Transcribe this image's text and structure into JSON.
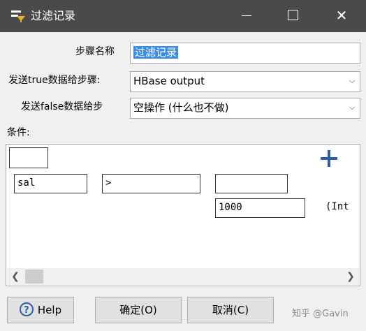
{
  "window": {
    "title": "过滤记录",
    "minimize_icon": "minimize-icon",
    "maximize_icon": "maximize-icon",
    "close_icon": "close-icon"
  },
  "form": {
    "step_name_label": "步骤名称",
    "step_name_value": "过滤记录",
    "true_step_label": "发送true数据给步骤:",
    "true_step_value": "HBase output",
    "false_step_label": "发送false数据给步",
    "false_step_value": "空操作 (什么也不做)",
    "conditions_label": "条件:"
  },
  "condition": {
    "top_box_value": "",
    "left_field": "sal",
    "operator": ">",
    "right_field": "",
    "constant_value": "1000",
    "constant_type": "(Int"
  },
  "buttons": {
    "help": "Help",
    "ok": "确定(O)",
    "cancel": "取消(C)"
  },
  "watermark": "知乎 @Gavin",
  "colors": {
    "titlebar": "#4a4a4a",
    "accent_blue": "#2d5fa8",
    "selection": "#3a8ee6"
  }
}
